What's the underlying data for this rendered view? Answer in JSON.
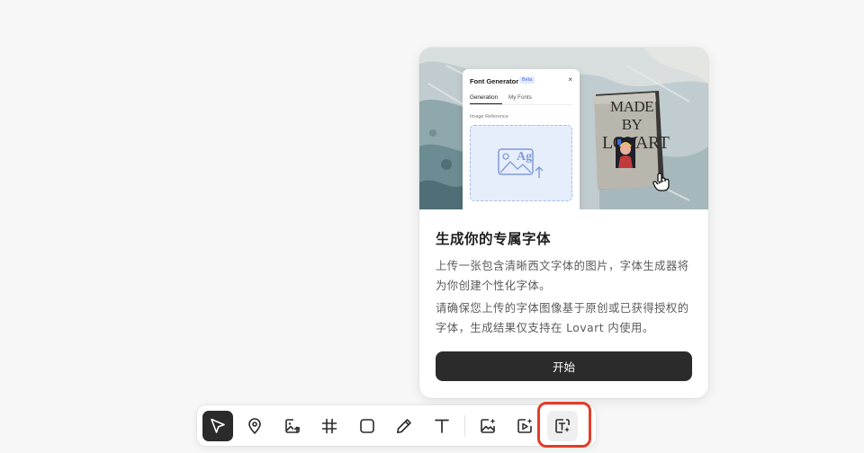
{
  "popover": {
    "banner": {
      "panel_title": "Font Generator",
      "panel_badge": "Beta",
      "panel_close": "×",
      "tab_generation": "Generation",
      "tab_my_fonts": "My Fonts",
      "image_reference_label": "Image Reference",
      "dropzone_icon_text": "Ag",
      "book_line1": "MADE BY",
      "book_line2": "LOVART"
    },
    "title": "生成你的专属字体",
    "description1": "上传一张包含清晰西文字体的图片，字体生成器将为你创建个性化字体。",
    "description2": "请确保您上传的字体图像基于原创或已获得授权的字体，生成结果仅支持在 Lovart 内使用。",
    "start_button": "开始"
  },
  "toolbar": {
    "tools": [
      {
        "name": "select",
        "icon": "cursor-arrow-icon",
        "active": true
      },
      {
        "name": "mark",
        "icon": "location-pin-icon"
      },
      {
        "name": "upload-image",
        "icon": "image-upload-icon"
      },
      {
        "name": "frame",
        "icon": "hash-frame-icon"
      },
      {
        "name": "shape",
        "icon": "rounded-square-icon"
      },
      {
        "name": "pencil",
        "icon": "pencil-icon"
      },
      {
        "name": "text",
        "icon": "text-t-icon"
      },
      {
        "name": "image-generator",
        "icon": "image-sparkle-icon"
      },
      {
        "name": "video-generator",
        "icon": "video-sparkle-icon"
      },
      {
        "name": "font-generator",
        "icon": "font-sparkle-icon",
        "hovered": true,
        "highlighted": true
      }
    ]
  },
  "colors": {
    "accent_dark": "#2b2b2b",
    "highlight_red": "#e23d2a",
    "dropzone_blue": "#e6eefc"
  }
}
